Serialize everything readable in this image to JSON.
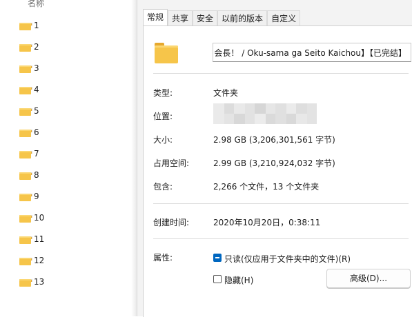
{
  "explorer": {
    "column_header": "名称",
    "folders": [
      "1",
      "2",
      "3",
      "4",
      "5",
      "6",
      "7",
      "8",
      "9",
      "10",
      "11",
      "12",
      "13"
    ]
  },
  "dialog": {
    "tabs": [
      {
        "label": "常规",
        "active": true
      },
      {
        "label": "共享",
        "active": false
      },
      {
        "label": "安全",
        "active": false
      },
      {
        "label": "以前的版本",
        "active": false
      },
      {
        "label": "自定义",
        "active": false
      }
    ],
    "folder_name": "会長！ / Oku-sama ga Seito Kaichou】【已完结】",
    "type_label": "类型:",
    "type_value": "文件夹",
    "location_label": "位置:",
    "size_label": "大小:",
    "size_value": "2.98 GB (3,206,301,561 字节)",
    "disk_size_label": "占用空间:",
    "disk_size_value": "2.99 GB (3,210,924,032 字节)",
    "contains_label": "包含:",
    "contains_value": "2,266 个文件，13 个文件夹",
    "created_label": "创建时间:",
    "created_value": "2020年10月20日，0:38:11",
    "attributes_label": "属性:",
    "readonly_label": "只读(仅应用于文件夹中的文件)(R)",
    "readonly_state": "indeterminate",
    "hidden_label": "隐藏(H)",
    "hidden_state": "unchecked",
    "advanced_button": "高级(D)..."
  },
  "colors": {
    "accent": "#0067c0",
    "folder_yellow": "#f6c54a",
    "dialog_bg": "#f3f3f3"
  }
}
